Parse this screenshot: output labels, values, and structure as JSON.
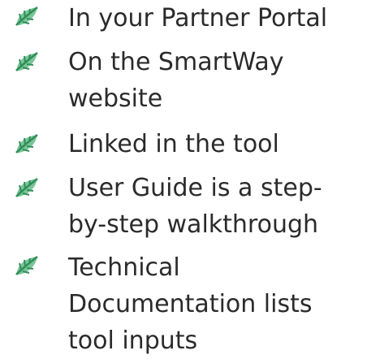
{
  "bullet_icon": "leaf-icon",
  "colors": {
    "text": "#2b2b2b",
    "leaf_dark": "#2f8f57",
    "leaf_light": "#7cc59a"
  },
  "items": [
    {
      "lines": [
        "In your Partner Portal"
      ]
    },
    {
      "lines": [
        "On the SmartWay",
        "website"
      ]
    },
    {
      "lines": [
        "Linked in the tool"
      ]
    },
    {
      "lines": [
        "User Guide is a step-",
        "by-step walkthrough"
      ]
    },
    {
      "lines": [
        "Technical",
        "Documentation lists",
        "tool inputs"
      ]
    }
  ]
}
